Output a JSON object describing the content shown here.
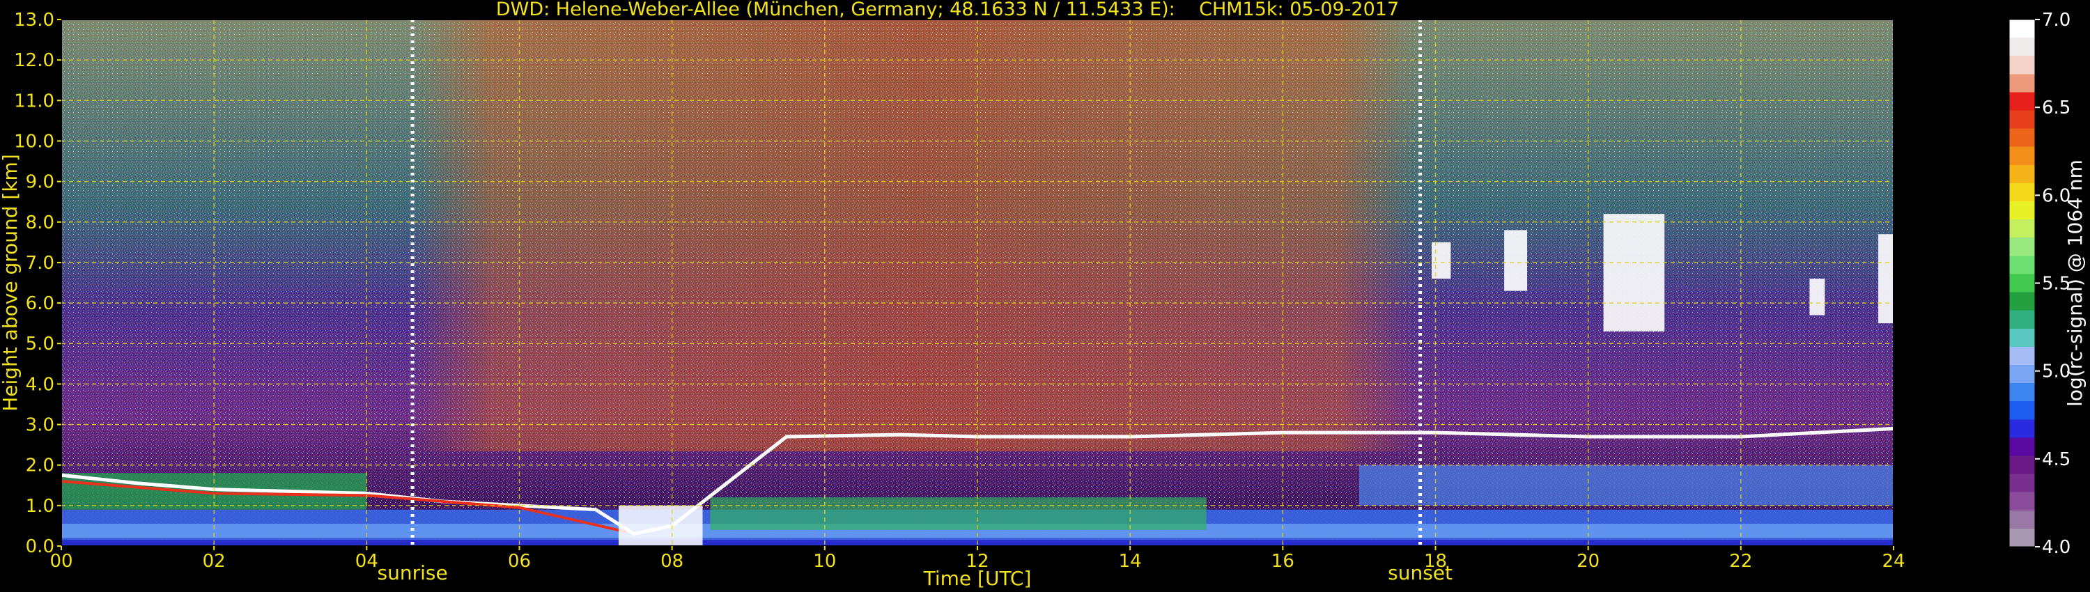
{
  "chart_data": {
    "type": "heatmap",
    "title": "DWD: Helene-Weber-Allee (München, Germany; 48.1633 N / 11.5433 E):    CHM15k: 05-09-2017",
    "xlabel": "Time [UTC]",
    "ylabel": "Height above ground [km]",
    "xlim": [
      0,
      24
    ],
    "ylim": [
      0,
      13
    ],
    "x_ticks": [
      0,
      2,
      4,
      6,
      8,
      10,
      12,
      14,
      16,
      18,
      20,
      22,
      24
    ],
    "x_tick_labels": [
      "00",
      "02",
      "04",
      "06",
      "08",
      "10",
      "12",
      "14",
      "16",
      "18",
      "20",
      "22",
      "24"
    ],
    "y_ticks": [
      0,
      1,
      2,
      3,
      4,
      5,
      6,
      7,
      8,
      9,
      10,
      11,
      12,
      13
    ],
    "y_tick_labels": [
      "0.0",
      "1.0",
      "2.0",
      "3.0",
      "4.0",
      "5.0",
      "6.0",
      "7.0",
      "8.0",
      "9.0",
      "10.0",
      "11.0",
      "12.0",
      "13.0"
    ],
    "grid": true,
    "events": [
      {
        "label": "sunrise",
        "time": 4.6
      },
      {
        "label": "sunset",
        "time": 17.8
      }
    ],
    "colorbar": {
      "label": "log(rc-signal) @ 1064 nm",
      "min": 4.0,
      "max": 7.0,
      "ticks": [
        4.0,
        4.5,
        5.0,
        5.5,
        6.0,
        6.5,
        7.0
      ],
      "tick_labels": [
        "4.0",
        "4.5",
        "5.0",
        "5.5",
        "6.0",
        "6.5",
        "7.0"
      ],
      "colors": [
        "#a898b0",
        "#9a78a6",
        "#8a4c9a",
        "#7a2e8e",
        "#6a1a86",
        "#5a0aa0",
        "#2a2ae0",
        "#1e5cf0",
        "#3c86f0",
        "#7aa4f4",
        "#a6bcf4",
        "#5ac8c0",
        "#30b080",
        "#24a040",
        "#40c850",
        "#6ce070",
        "#9ae880",
        "#c4f060",
        "#e8f028",
        "#f4d81c",
        "#f4b418",
        "#f4901a",
        "#ec6418",
        "#e8401c",
        "#e8201c",
        "#ec9a7a",
        "#f4d4c8",
        "#f0ecec",
        "#ffffff"
      ]
    },
    "colors": {
      "text": "#f2e21c",
      "grid": "#e0d21a",
      "event_line": "#ffffff",
      "background": "#000000"
    }
  }
}
